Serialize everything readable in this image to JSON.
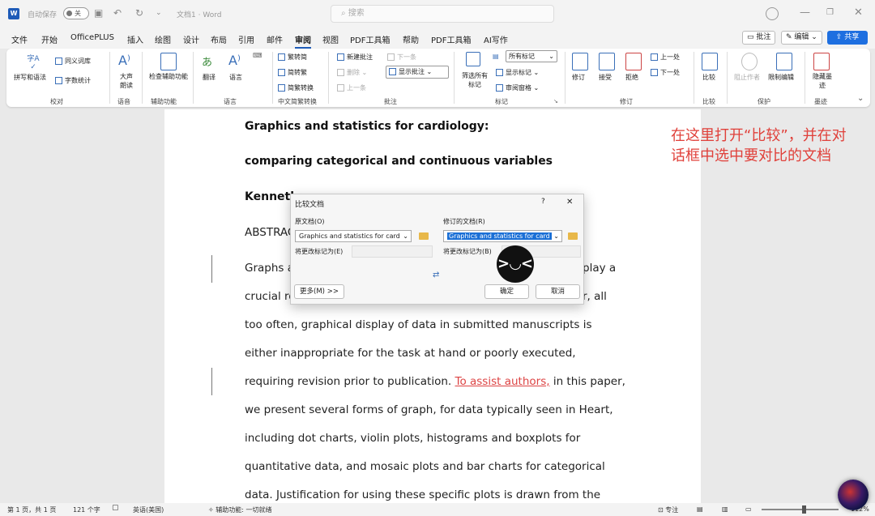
{
  "titlebar": {
    "autosave_label": "自动保存",
    "autosave_state": "关",
    "doc_name": "文档1",
    "sep": "·",
    "app": "Word",
    "search_placeholder": "搜索"
  },
  "menu": {
    "items": [
      "文件",
      "开始",
      "OfficePLUS",
      "插入",
      "绘图",
      "设计",
      "布局",
      "引用",
      "邮件",
      "审阅",
      "视图",
      "PDF工具箱",
      "帮助",
      "PDF工具箱",
      "AI写作"
    ],
    "active": "审阅"
  },
  "topright": {
    "comment": "批注",
    "edit": "编辑",
    "share": "共享"
  },
  "ribbon": {
    "spelling": "拼写和语法",
    "thesaurus": "同义词库",
    "wordcount": "字数统计",
    "proofing_group": "校对",
    "readaloud": "大声朗读",
    "speech_group": "语音",
    "check_access": "检查辅助功能",
    "access_group": "辅助功能",
    "translate": "翻译",
    "language": "语言",
    "language_group": "语言",
    "to_trad": "繁转简",
    "to_simp": "简转繁",
    "convert": "简繁转换",
    "chinese_group": "中文简繁转换",
    "new_comment": "新建批注",
    "delete": "删除",
    "prev": "上一条",
    "next": "下一条",
    "show_comments": "显示批注",
    "comments_group": "批注",
    "filter_markup": "筛选所有标记",
    "all_markup": "所有标记",
    "show_markup": "显示标记",
    "review_pane": "审阅窗格",
    "tracking_group": "标记",
    "revise": "修订",
    "accept": "接受",
    "reject": "拒绝",
    "prev_change": "上一处",
    "next_change": "下一处",
    "changes_group": "修订",
    "compare": "比较",
    "compare_group": "比较",
    "block_authors": "阻止作者",
    "restrict": "限制编辑",
    "protect_group": "保护",
    "hide_ink": "隐藏墨迹",
    "ink_group": "墨迹"
  },
  "document": {
    "title1": "Graphics and statistics for cardiology:",
    "title2": "comparing categorical and continuous variables",
    "author": "Kenneth",
    "abstract": "ABSTRAC",
    "lines": [
      {
        "pre": "Graphs a",
        "track": "",
        "post": "play a"
      },
      {
        "pre": "crucial ro",
        "track": "",
        "post": "r, all"
      },
      {
        "pre": "too often, graphical display of data in submitted manuscripts is",
        "track": "",
        "post": ""
      },
      {
        "pre": "either inappropriate for the task at hand or poorly executed,",
        "track": "",
        "post": ""
      },
      {
        "pre": "requiring revision prior to publication. ",
        "track": "To assist authors,",
        "post": " in this paper,"
      },
      {
        "pre": "we present several forms of graph, for data typically seen in Heart,",
        "track": "",
        "post": ""
      },
      {
        "pre": "including dot charts, violin plots, histograms and boxplots for",
        "track": "",
        "post": ""
      },
      {
        "pre": "quantitative data, and mosaic plots and bar charts for categorical",
        "track": "",
        "post": ""
      },
      {
        "pre": "data. Justification for using these specific plots is drawn from the",
        "track": "",
        "post": ""
      }
    ]
  },
  "annotation": "在这里打开“比较”，并在对话框中选中要对比的文档",
  "dialog": {
    "title": "比较文档",
    "help": "?",
    "close": "✕",
    "original_label": "原文档(O)",
    "original_value": "Graphics and statistics for card",
    "revised_label": "修订的文档(R)",
    "revised_value": "Graphics and statistics for card",
    "label_orig": "将更改标记为(E)",
    "label_rev": "将更改标记为(B)",
    "more": "更多(M) >>",
    "ok": "确定",
    "cancel": "取消"
  },
  "status": {
    "page": "第 1 页，共 1 页",
    "words": "121 个字",
    "lang": "英语(美国)",
    "access": "辅助功能: 一切就绪",
    "focus": "专注",
    "zoom": "112%"
  },
  "colors": {
    "accent": "#1e6fe0",
    "annotation": "#e0403a",
    "track_change": "#d44"
  }
}
